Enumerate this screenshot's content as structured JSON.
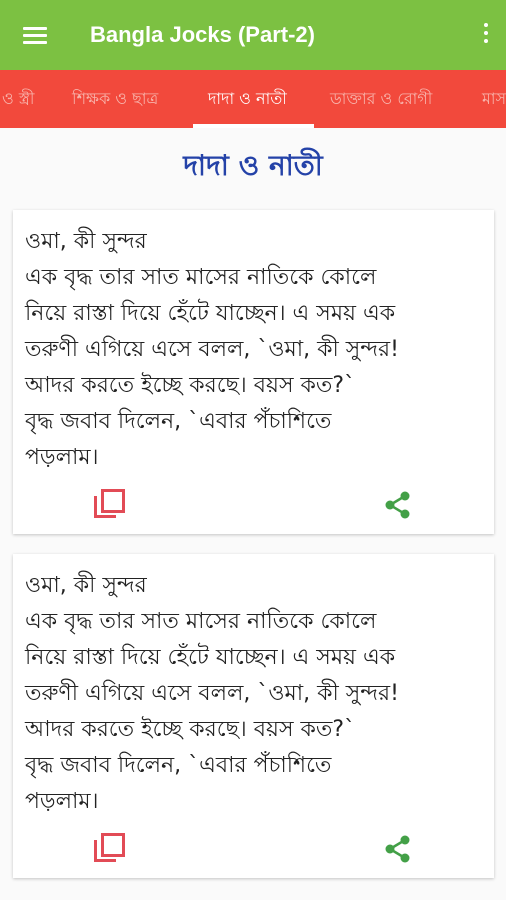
{
  "app": {
    "title": "Bangla Jocks (Part-2)"
  },
  "tabs": [
    {
      "label": "ও স্ত্রী"
    },
    {
      "label": "শিক্ষক ও ছাত্র"
    },
    {
      "label": "দাদা ও নাতী"
    },
    {
      "label": "ডাক্তার ও রোগী"
    },
    {
      "label": "মাস"
    }
  ],
  "section": {
    "title": "দাদা ও নাতী"
  },
  "jokes": [
    {
      "lines": [
        "ওমা, কী সুন্দর",
        "এক বৃদ্ধ তার সাত মাসের নাতিকে কোলে",
        "নিয়ে রাস্তা দিয়ে হেঁটে যাচ্ছেন। এ সময় এক",
        "তরুণী এগিয়ে এসে বলল, `ওমা, কী সুন্দর!",
        "আদর করতে ইচ্ছে করছে। বয়স কত?`",
        "বৃদ্ধ জবাব দিলেন, `এবার পঁচাশিতে",
        "পড়লাম।"
      ]
    },
    {
      "lines": [
        "ওমা, কী সুন্দর",
        "এক বৃদ্ধ তার সাত মাসের নাতিকে কোলে",
        "নিয়ে রাস্তা দিয়ে হেঁটে যাচ্ছেন। এ সময় এক",
        "তরুণী এগিয়ে এসে বলল, `ওমা, কী সুন্দর!",
        "আদর করতে ইচ্ছে করছে। বয়স কত?`",
        "বৃদ্ধ জবাব দিলেন, `এবার পঁচাশিতে",
        "পড়লাম।"
      ]
    }
  ],
  "icons": {
    "menu": "hamburger-menu-icon",
    "overflow": "more-vert-icon",
    "copy": "copy-icon",
    "share": "share-icon"
  },
  "colors": {
    "appbar": "#7cc142",
    "tabbar": "#f2493c",
    "title": "#2442a8",
    "copy": "#e24b56",
    "share": "#43a047"
  }
}
